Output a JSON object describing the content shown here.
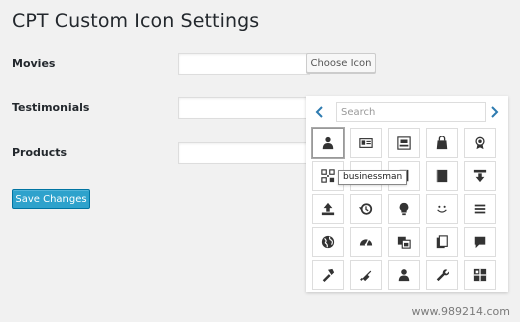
{
  "page": {
    "title": "CPT Custom Icon Settings",
    "rows": [
      {
        "label": "Movies",
        "value": ""
      },
      {
        "label": "Testimonials",
        "value": ""
      },
      {
        "label": "Products",
        "value": ""
      }
    ],
    "choose_icon_label": "Choose Icon",
    "save_label": "Save Changes"
  },
  "picker": {
    "search_placeholder": "Search",
    "prev_icon": "chevron-left",
    "next_icon": "chevron-right",
    "tooltip": "businessman",
    "selected_index": 0,
    "icons": [
      "businessman",
      "id-card",
      "portfolio",
      "cart",
      "awards",
      "screenoptions",
      "id",
      "book-alt",
      "book",
      "download",
      "upload",
      "backup",
      "lightbulb",
      "smiley",
      "menu",
      "admin-site",
      "dashboard",
      "images-alt",
      "admin-page",
      "format-status",
      "hammer",
      "admin-plugins",
      "admin-users",
      "admin-tools",
      "editor-table"
    ]
  },
  "colors": {
    "accent": "#2ea2cc",
    "background": "#f1f1f1"
  },
  "watermark": "www.989214.com"
}
